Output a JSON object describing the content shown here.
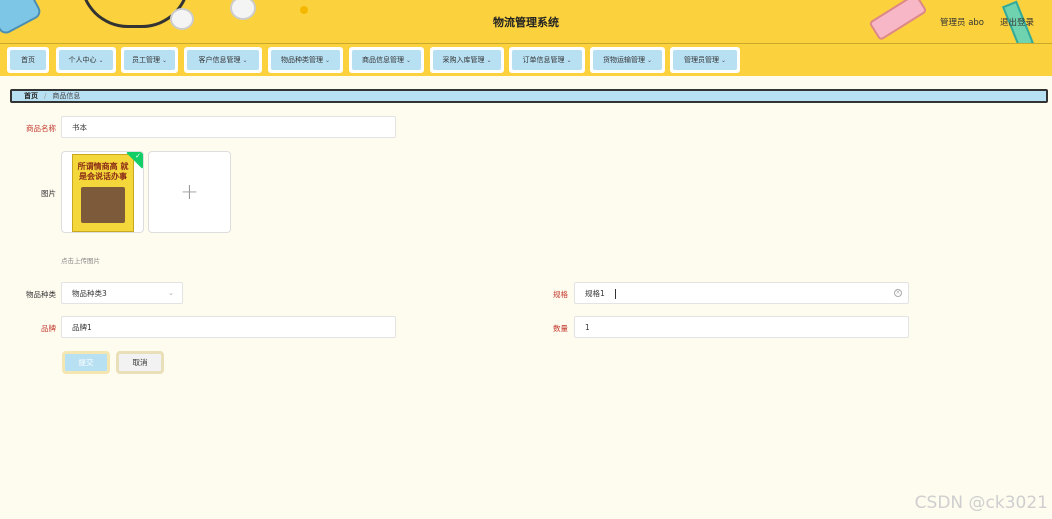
{
  "header": {
    "title": "物流管理系统",
    "user_label": "管理员 abo",
    "logout_label": "退出登录"
  },
  "nav": [
    {
      "label": "首页",
      "has_dropdown": false
    },
    {
      "label": "个人中心",
      "has_dropdown": true
    },
    {
      "label": "员工管理",
      "has_dropdown": true
    },
    {
      "label": "客户信息管理",
      "has_dropdown": true
    },
    {
      "label": "物品种类管理",
      "has_dropdown": true
    },
    {
      "label": "商品信息管理",
      "has_dropdown": true
    },
    {
      "label": "采购入库管理",
      "has_dropdown": true
    },
    {
      "label": "订单信息管理",
      "has_dropdown": true
    },
    {
      "label": "货物运输管理",
      "has_dropdown": true
    },
    {
      "label": "管理员管理",
      "has_dropdown": true
    }
  ],
  "breadcrumb": {
    "home": "首页",
    "separator": "/",
    "current": "商品信息"
  },
  "form": {
    "name_label": "商品名称",
    "name_value": "书本",
    "image_label": "图片",
    "image_tip": "点击上传图片",
    "book_title": "所谓情商高 就是会说话办事",
    "upload_plus": "+",
    "category_label": "物品种类",
    "category_value": "物品种类3",
    "spec_label": "规格",
    "spec_value": "规格1",
    "brand_label": "品牌",
    "brand_value": "品牌1",
    "qty_label": "数量",
    "qty_value": "1",
    "submit_label": "提交",
    "cancel_label": "取消"
  },
  "watermark": "CSDN @ck3021",
  "colors": {
    "header_bg": "#fbd23d",
    "nav_item_bg": "#b8e0f3",
    "page_bg": "#fefbef",
    "required": "#c0392b"
  }
}
